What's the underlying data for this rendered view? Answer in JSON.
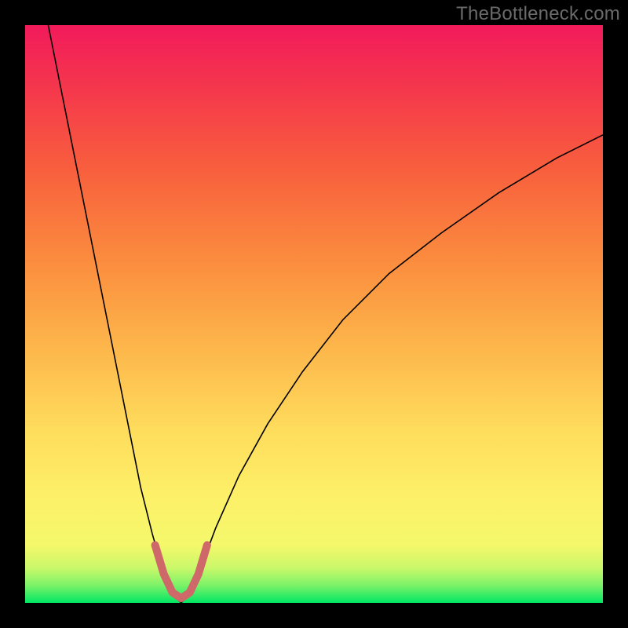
{
  "watermark": "TheBottleneck.com",
  "chart_data": {
    "type": "line",
    "title": "",
    "xlabel": "",
    "ylabel": "",
    "xlim": [
      0,
      100
    ],
    "ylim": [
      0,
      100
    ],
    "grid": false,
    "legend": false,
    "gradient_stops": [
      {
        "offset": 0.0,
        "color": "#00e765"
      },
      {
        "offset": 0.03,
        "color": "#7bf268"
      },
      {
        "offset": 0.06,
        "color": "#c9f86a"
      },
      {
        "offset": 0.1,
        "color": "#f4f86a"
      },
      {
        "offset": 0.18,
        "color": "#fdf169"
      },
      {
        "offset": 0.3,
        "color": "#fedc5c"
      },
      {
        "offset": 0.45,
        "color": "#fdb44a"
      },
      {
        "offset": 0.6,
        "color": "#fb8a3e"
      },
      {
        "offset": 0.75,
        "color": "#f85f3d"
      },
      {
        "offset": 0.88,
        "color": "#f53a4b"
      },
      {
        "offset": 1.0,
        "color": "#f21a5b"
      }
    ],
    "series": [
      {
        "name": "curve",
        "stroke": "#000000",
        "stroke_width": 1.6,
        "points": [
          {
            "x": 4.0,
            "y": 100.0
          },
          {
            "x": 6.0,
            "y": 90.0
          },
          {
            "x": 8.0,
            "y": 80.0
          },
          {
            "x": 10.0,
            "y": 70.0
          },
          {
            "x": 12.0,
            "y": 60.0
          },
          {
            "x": 14.0,
            "y": 50.0
          },
          {
            "x": 16.0,
            "y": 40.0
          },
          {
            "x": 18.0,
            "y": 30.0
          },
          {
            "x": 20.0,
            "y": 20.0
          },
          {
            "x": 22.0,
            "y": 12.0
          },
          {
            "x": 24.0,
            "y": 5.0
          },
          {
            "x": 25.5,
            "y": 1.5
          },
          {
            "x": 27.0,
            "y": 0.0
          },
          {
            "x": 28.5,
            "y": 1.5
          },
          {
            "x": 30.0,
            "y": 5.0
          },
          {
            "x": 33.0,
            "y": 13.0
          },
          {
            "x": 37.0,
            "y": 22.0
          },
          {
            "x": 42.0,
            "y": 31.0
          },
          {
            "x": 48.0,
            "y": 40.0
          },
          {
            "x": 55.0,
            "y": 49.0
          },
          {
            "x": 63.0,
            "y": 57.0
          },
          {
            "x": 72.0,
            "y": 64.0
          },
          {
            "x": 82.0,
            "y": 71.0
          },
          {
            "x": 92.0,
            "y": 77.0
          },
          {
            "x": 100.0,
            "y": 81.0
          }
        ]
      },
      {
        "name": "marker",
        "stroke": "#cf6868",
        "stroke_width": 10,
        "linecap": "round",
        "points": [
          {
            "x": 22.5,
            "y": 10.0
          },
          {
            "x": 24.0,
            "y": 5.0
          },
          {
            "x": 25.5,
            "y": 1.8
          },
          {
            "x": 27.0,
            "y": 0.8
          },
          {
            "x": 28.5,
            "y": 1.8
          },
          {
            "x": 30.0,
            "y": 5.0
          },
          {
            "x": 31.5,
            "y": 10.0
          }
        ]
      }
    ]
  }
}
